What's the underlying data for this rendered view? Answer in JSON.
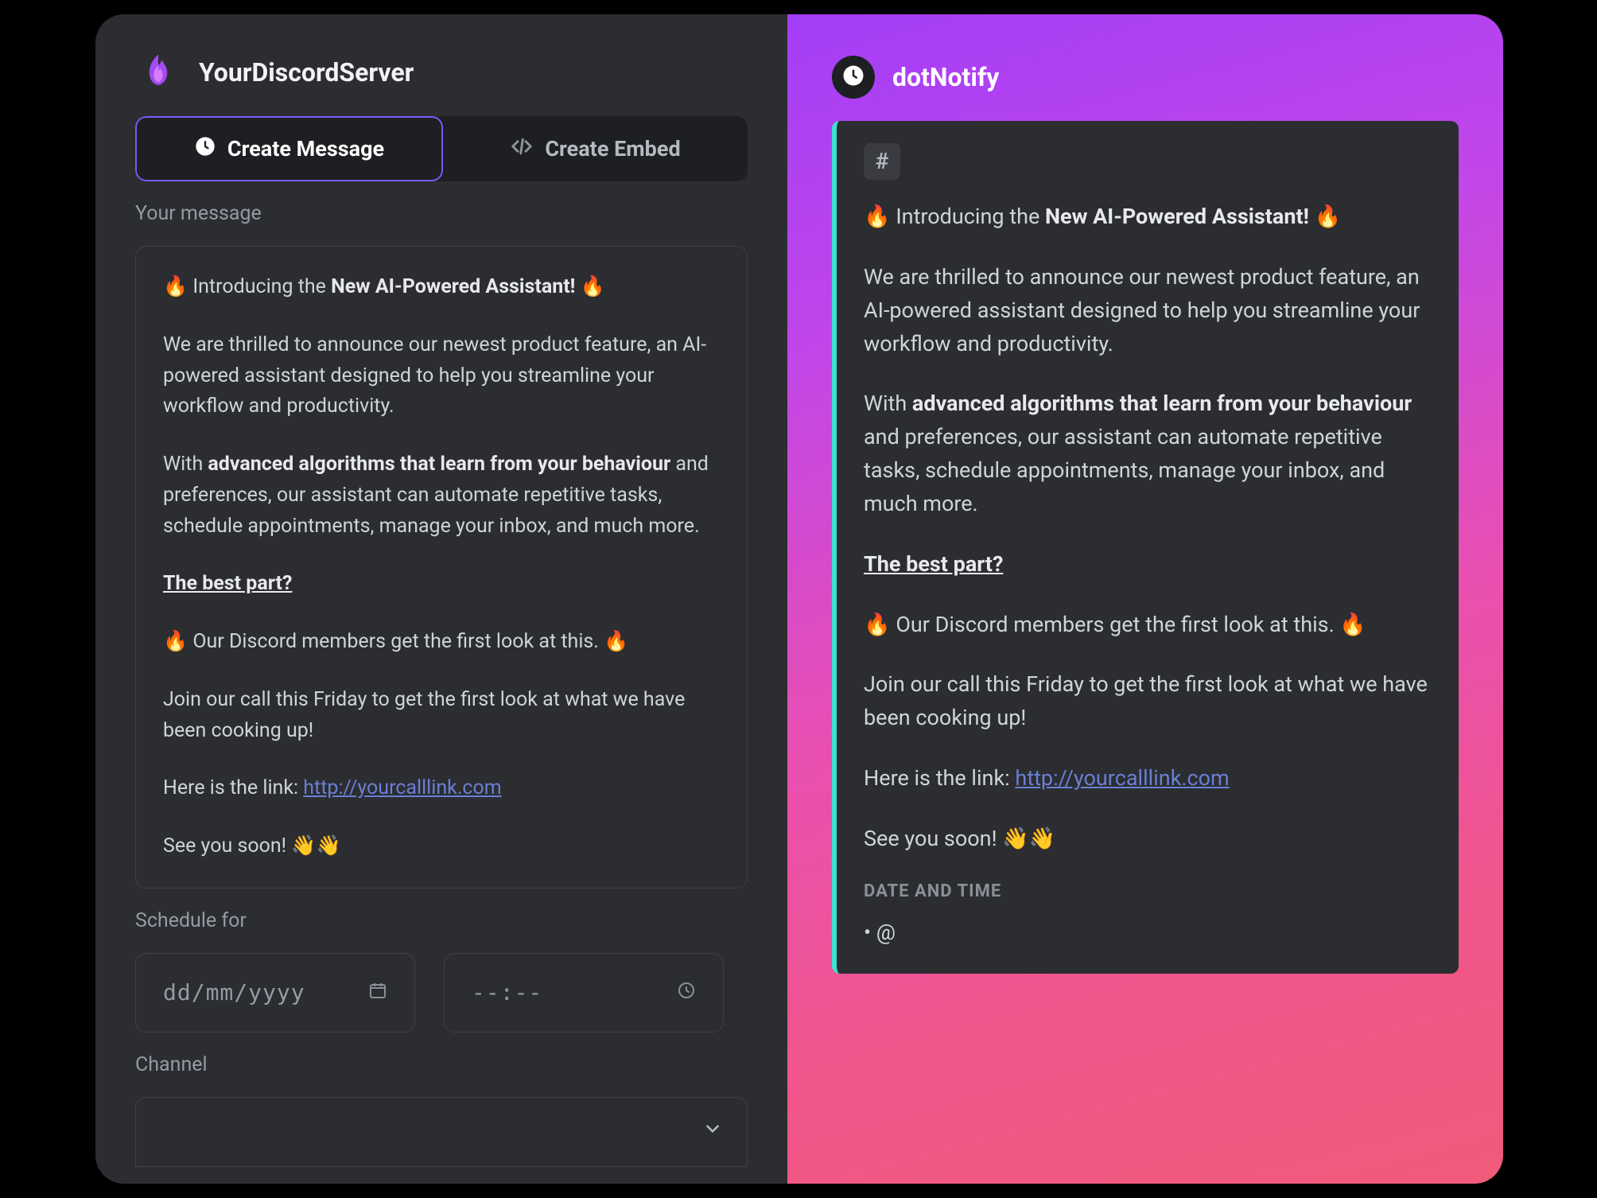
{
  "server": {
    "name": "YourDiscordServer"
  },
  "tabs": {
    "create_message": "Create Message",
    "create_embed": "Create Embed"
  },
  "labels": {
    "your_message": "Your message",
    "schedule_for": "Schedule for",
    "channel": "Channel"
  },
  "inputs": {
    "date_placeholder": "dd/mm/yyyy",
    "time_placeholder": "--:--"
  },
  "preview": {
    "username": "dotNotify",
    "hash": "#",
    "date_time_label": "DATE AND TIME",
    "bullet_at": "• @"
  },
  "message": {
    "intro_prefix": "🔥 Introducing the ",
    "intro_bold": "New AI-Powered Assistant!",
    "intro_suffix": " 🔥",
    "para2": "We are thrilled to announce our newest product feature, an AI-powered assistant designed to help you streamline your workflow and productivity.",
    "para3_prefix": "With ",
    "para3_bold": "advanced algorithms that learn from your behaviour",
    "para3_suffix": " and preferences, our assistant can automate repetitive tasks, schedule appointments, manage your inbox, and much more.",
    "best_part": "The best part?",
    "members_line": "🔥 Our Discord members get the first look at this. 🔥",
    "join_call": "Join our call this Friday to get the first look at what we have been cooking up!",
    "link_prefix": " Here is the link: ",
    "link_text": "http://yourcalllink.com",
    "see_you": " See you soon! 👋👋"
  }
}
